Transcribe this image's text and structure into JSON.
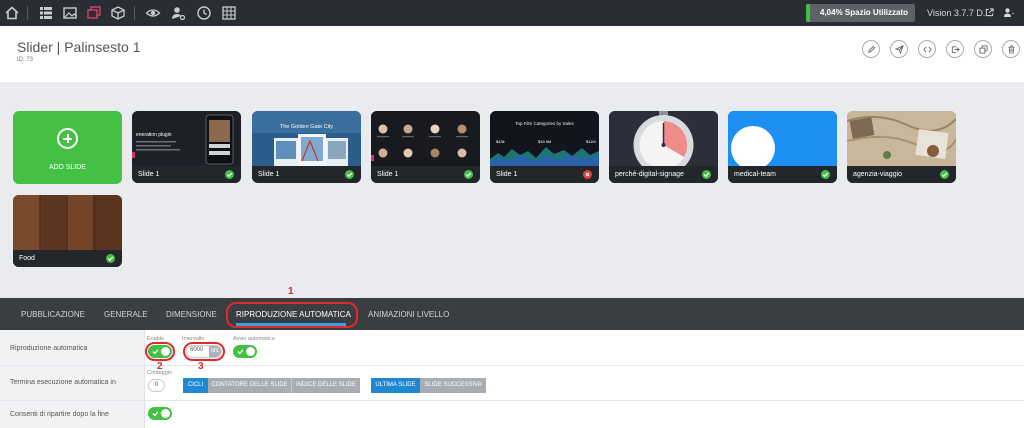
{
  "topbar": {
    "usage_text": "4,04% Spazio Utilizzato",
    "usage_percent": 4.04,
    "version": "Vision 3.7.7 D...",
    "icons": [
      "home-icon",
      "list-icon",
      "image-icon",
      "layers-icon",
      "cube-icon",
      "eye-icon",
      "user-settings-icon",
      "clock-icon",
      "grid-icon",
      "external-link-icon",
      "user-icon"
    ]
  },
  "header": {
    "title": "Slider | Palinsesto 1",
    "id_label": "ID: 73",
    "actions": [
      "edit-icon",
      "send-icon",
      "code-icon",
      "export-icon",
      "duplicate-icon",
      "trash-icon"
    ]
  },
  "add_slide": {
    "label": "ADD SLIDE"
  },
  "slides": [
    {
      "name": "Slide 1",
      "status": "ok",
      "thumb_text": "eneration plugin"
    },
    {
      "name": "Slide 1",
      "status": "ok",
      "thumb_text": "The Golden Gate City"
    },
    {
      "name": "Slide 1",
      "status": "ok",
      "thumb_text": ""
    },
    {
      "name": "Slide 1",
      "status": "error",
      "thumb_text": "Top Film Categories by Sales",
      "thumb_values": [
        "$43k",
        "$34.9M",
        "$11M"
      ]
    },
    {
      "name": "perché-digital-signage",
      "status": "ok",
      "thumb_text": ""
    },
    {
      "name": "medical-team",
      "status": "ok",
      "thumb_text": ""
    },
    {
      "name": "agenzia-viaggio",
      "status": "ok",
      "thumb_text": ""
    },
    {
      "name": "Food",
      "status": "ok",
      "thumb_text": ""
    }
  ],
  "tabs": [
    {
      "label": "PUBBLICAZIONE",
      "active": false
    },
    {
      "label": "GENERALE",
      "active": false
    },
    {
      "label": "DIMENSIONE",
      "active": false
    },
    {
      "label": "RIPRODUZIONE AUTOMATICA",
      "active": true
    },
    {
      "label": "ANIMAZIONI LIVELLO",
      "active": false
    }
  ],
  "annotations": {
    "tab_step": "1",
    "toggle_step": "2",
    "interval_step": "3"
  },
  "colors": {
    "accent": "#1e88d2",
    "success": "#44c144",
    "highlight": "#e02b2b"
  },
  "settings": {
    "autoplay": {
      "label": "Riproduzione automatica",
      "enable_label": "Enable",
      "enable_on": true,
      "interval_label": "Intervallo",
      "interval_value": "6000",
      "interval_unit": "MS",
      "autostart_label": "Avvio automatico",
      "autostart_on": true
    },
    "stop_at": {
      "label": "Termina esecuzione automatica in",
      "counter_label": "Conteggio",
      "counter_value": "0",
      "group1": [
        {
          "label": "CICLI",
          "selected": true
        },
        {
          "label": "CONTATORE DELLE SLIDE",
          "selected": false
        },
        {
          "label": "INDICE DELLE SLIDE",
          "selected": false
        }
      ],
      "group2": [
        {
          "label": "ULTIMA SLIDE",
          "selected": true
        },
        {
          "label": "SLIDE SUCCESSIVA",
          "selected": false
        }
      ]
    },
    "restart": {
      "label": "Consenti di ripartire dopo la fine",
      "on": true
    }
  }
}
